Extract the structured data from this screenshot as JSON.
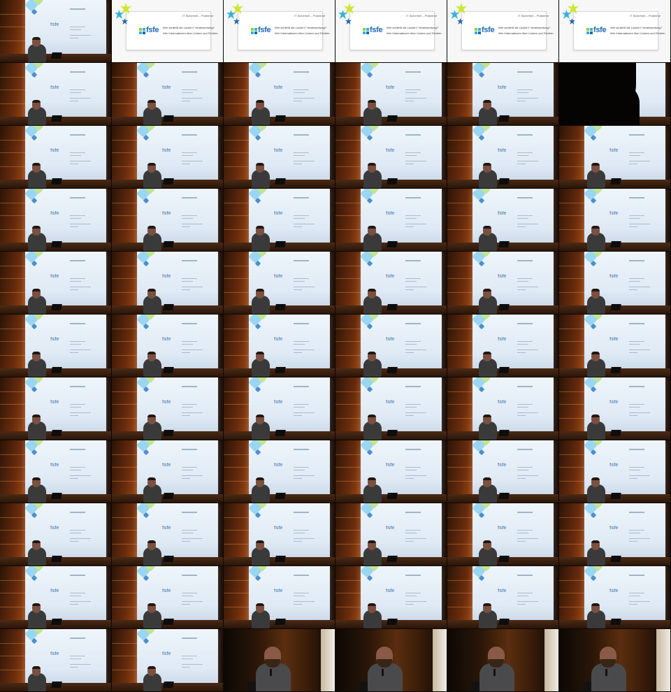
{
  "layout": {
    "columns": 6,
    "rows": 11
  },
  "slide": {
    "title": "IT Sicherheit – Probleme",
    "logo": "fsfe",
    "bullets": [
      "Wer schließt die Lücken? Verantwortung?",
      "Wer Informationen über Lücken und Fehlern"
    ]
  },
  "stage_slide_logo": "fsfe",
  "frames": [
    "stage",
    "slide",
    "slide",
    "slide",
    "slide",
    "slide",
    "stage",
    "stage",
    "stage",
    "stage",
    "stage",
    "silhouette",
    "stage",
    "stage",
    "stage",
    "stage",
    "stage",
    "stage",
    "stage",
    "stage",
    "stage",
    "stage",
    "stage",
    "stage",
    "stage",
    "stage",
    "stage",
    "stage",
    "stage",
    "stage",
    "stage",
    "stage",
    "stage",
    "stage",
    "stage",
    "stage",
    "stage",
    "stage",
    "stage",
    "stage",
    "stage",
    "stage",
    "stage",
    "stage",
    "stage",
    "stage",
    "stage",
    "stage",
    "stage",
    "stage",
    "stage",
    "stage",
    "stage",
    "stage",
    "stage",
    "stage",
    "stage",
    "stage",
    "stage",
    "stage",
    "stage",
    "stage",
    "close",
    "close",
    "close",
    "close"
  ]
}
